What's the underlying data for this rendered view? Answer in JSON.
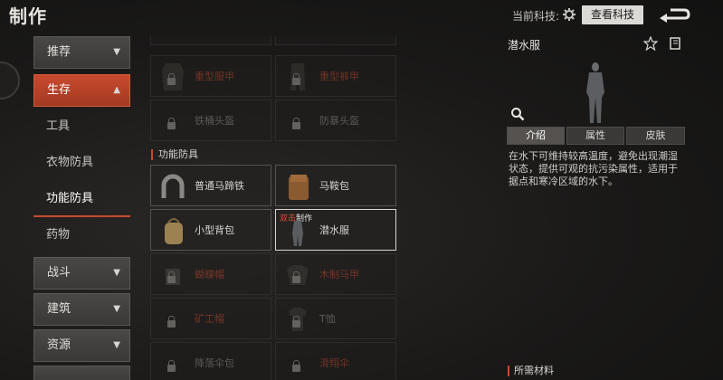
{
  "header": {
    "title": "制作",
    "current_tech_label": "当前科技:",
    "view_tech_button": "查看科技"
  },
  "sidebar": {
    "categories": [
      {
        "label": "推荐",
        "arrow": "▼"
      },
      {
        "label": "生存",
        "arrow": "▲"
      },
      {
        "label": "战斗",
        "arrow": "▼"
      },
      {
        "label": "建筑",
        "arrow": "▼"
      },
      {
        "label": "资源",
        "arrow": "▼"
      }
    ],
    "subcategories": [
      {
        "label": "工具"
      },
      {
        "label": "衣物防具"
      },
      {
        "label": "功能防具"
      },
      {
        "label": "药物"
      }
    ]
  },
  "grid": {
    "top_items": [
      {
        "name": "重型服甲",
        "state": "locked-red"
      },
      {
        "name": "重型裤甲",
        "state": "locked-red"
      },
      {
        "name": "铁桶头盔",
        "state": "locked"
      },
      {
        "name": "防暴头盔",
        "state": "locked"
      }
    ],
    "section_title": "功能防具",
    "items": [
      {
        "name": "普通马蹄铁",
        "state": "available"
      },
      {
        "name": "马鞍包",
        "state": "available"
      },
      {
        "name": "小型背包",
        "state": "available"
      },
      {
        "name": "潜水服",
        "state": "selected",
        "badge_prefix": "双击",
        "badge_suffix": "制作"
      },
      {
        "name": "蝴蝶帽",
        "state": "locked-red"
      },
      {
        "name": "木制马甲",
        "state": "locked-red"
      },
      {
        "name": "矿工帽",
        "state": "locked-red"
      },
      {
        "name": "T恤",
        "state": "locked"
      },
      {
        "name": "降落伞包",
        "state": "locked"
      },
      {
        "name": "滑翔伞",
        "state": "locked-red"
      }
    ]
  },
  "detail": {
    "name": "潜水服",
    "tabs": [
      "介绍",
      "属性",
      "皮肤"
    ],
    "active_tab": "介绍",
    "description": "在水下可维持较高温度，避免出现潮湿状态，提供可观的抗污染属性，适用于据点和寒冷区域的水下。",
    "materials_title": "所需材料"
  },
  "colors": {
    "accent": "#c84a2e",
    "locked_text": "#b8442c"
  }
}
